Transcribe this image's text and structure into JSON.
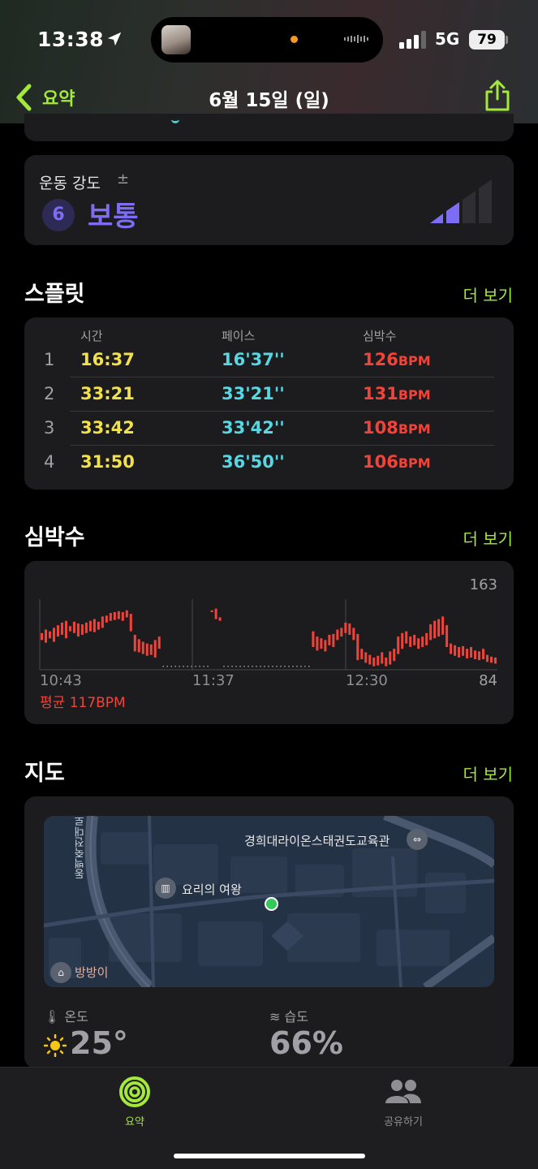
{
  "status_bar": {
    "time": "13:38",
    "network": "5G",
    "battery": "79"
  },
  "nav": {
    "back_label": "요약",
    "title": "6월 15일 (일)"
  },
  "effort": {
    "label": "운동 강도",
    "plus_minus": "±",
    "level": "6",
    "level_word": "보통",
    "color": "#7d6cf4"
  },
  "splits": {
    "title": "스플릿",
    "more": "더 보기",
    "headers": {
      "time": "시간",
      "pace": "페이스",
      "heart_rate": "심박수"
    },
    "rows": [
      {
        "index": "1",
        "time": "16:37",
        "pace": "16'37''",
        "hr": "126",
        "unit": "BPM"
      },
      {
        "index": "2",
        "time": "33:21",
        "pace": "33'21''",
        "hr": "131",
        "unit": "BPM"
      },
      {
        "index": "3",
        "time": "33:42",
        "pace": "33'42''",
        "hr": "108",
        "unit": "BPM"
      },
      {
        "index": "4",
        "time": "31:50",
        "pace": "36'50''",
        "hr": "106",
        "unit": "BPM"
      }
    ]
  },
  "heart_rate": {
    "title": "심박수",
    "more": "더 보기",
    "max_label": "163",
    "min_label": "84",
    "x_ticks": [
      "10:43",
      "11:37",
      "12:30"
    ],
    "avg_label": "평균",
    "avg_value": "117BPM",
    "color": "#f2433a",
    "y_range": [
      84,
      163
    ],
    "samples": [
      [
        118,
        126
      ],
      [
        115,
        130
      ],
      [
        120,
        128
      ],
      [
        116,
        132
      ],
      [
        122,
        135
      ],
      [
        124,
        138
      ],
      [
        120,
        140
      ],
      [
        128,
        134
      ],
      [
        126,
        139
      ],
      [
        122,
        137
      ],
      [
        124,
        136
      ],
      [
        126,
        138
      ],
      [
        128,
        140
      ],
      [
        127,
        142
      ],
      [
        130,
        139
      ],
      [
        132,
        145
      ],
      [
        138,
        146
      ],
      [
        140,
        149
      ],
      [
        141,
        150
      ],
      [
        142,
        151
      ],
      [
        140,
        150
      ],
      [
        144,
        152
      ],
      [
        128,
        148
      ],
      [
        105,
        124
      ],
      [
        104,
        119
      ],
      [
        102,
        116
      ],
      [
        100,
        114
      ],
      [
        101,
        113
      ],
      [
        98,
        118
      ],
      [
        108,
        122
      ],
      null,
      null,
      null,
      null,
      null,
      null,
      null,
      null,
      null,
      null,
      null,
      null,
      [
        150,
        152
      ],
      [
        142,
        154
      ],
      [
        140,
        144
      ],
      null,
      null,
      null,
      null,
      null,
      null,
      null,
      null,
      null,
      null,
      null,
      null,
      null,
      null,
      null,
      null,
      null,
      null,
      null,
      null,
      null,
      null,
      [
        110,
        128
      ],
      [
        106,
        122
      ],
      [
        108,
        120
      ],
      [
        105,
        118
      ],
      [
        112,
        124
      ],
      [
        110,
        125
      ],
      [
        118,
        130
      ],
      [
        122,
        132
      ],
      [
        126,
        138
      ],
      [
        124,
        137
      ],
      [
        118,
        132
      ],
      [
        95,
        125
      ],
      [
        96,
        108
      ],
      [
        92,
        104
      ],
      [
        90,
        101
      ],
      [
        88,
        98
      ],
      [
        89,
        100
      ],
      [
        91,
        104
      ],
      [
        88,
        98
      ],
      [
        90,
        105
      ],
      [
        94,
        108
      ],
      [
        102,
        122
      ],
      [
        108,
        126
      ],
      [
        114,
        128
      ],
      [
        110,
        122
      ],
      [
        112,
        124
      ],
      [
        108,
        120
      ],
      [
        110,
        122
      ],
      [
        112,
        126
      ],
      [
        118,
        136
      ],
      [
        120,
        140
      ],
      [
        122,
        142
      ],
      [
        124,
        145
      ],
      [
        110,
        135
      ],
      [
        102,
        114
      ],
      [
        100,
        112
      ],
      [
        98,
        110
      ],
      [
        100,
        111
      ],
      [
        97,
        108
      ],
      [
        98,
        110
      ],
      [
        96,
        106
      ],
      [
        95,
        105
      ],
      [
        96,
        108
      ],
      [
        93,
        101
      ],
      [
        92,
        99
      ],
      [
        91,
        98
      ]
    ]
  },
  "map_section": {
    "title": "지도",
    "more": "더 보기",
    "labels": {
      "gym": "경희대라이온스태권도교육관",
      "restaurant": "요리의 여왕",
      "kids": "방방이",
      "road": "동백죽전대로"
    },
    "weather": {
      "temp_label": "온도",
      "temp_value": "25°",
      "humidity_label": "습도",
      "humidity_value": "66%"
    }
  },
  "tabbar": {
    "summary": "요약",
    "sharing": "공유하기",
    "accent": "#a4e83c"
  }
}
